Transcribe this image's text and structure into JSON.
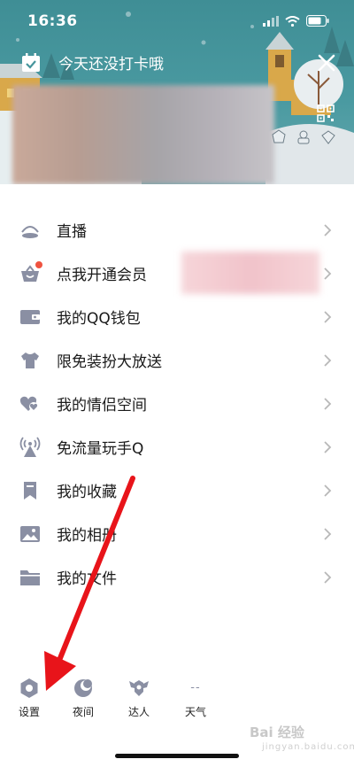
{
  "status_bar": {
    "time": "16:36",
    "icons": [
      "signal-icon",
      "wifi-icon",
      "battery-icon"
    ]
  },
  "header": {
    "checkin_text": "今天还没打卡哦",
    "checkin_icon": "calendar-check-icon",
    "close_icon": "close-icon",
    "qr_icon": "qr-code-icon",
    "badge_icons": [
      "badge-1-icon",
      "badge-2-icon",
      "badge-3-icon"
    ]
  },
  "menu": {
    "items": [
      {
        "label": "直播",
        "icon": "live-icon"
      },
      {
        "label": "点我开通会员",
        "icon": "vip-basket-icon",
        "has_red_dot": true
      },
      {
        "label": "我的QQ钱包",
        "icon": "wallet-icon"
      },
      {
        "label": "限免装扮大放送",
        "icon": "tshirt-icon"
      },
      {
        "label": "我的情侣空间",
        "icon": "hearts-icon"
      },
      {
        "label": "免流量玩手Q",
        "icon": "signal-tower-icon"
      },
      {
        "label": "我的收藏",
        "icon": "bookmark-icon"
      },
      {
        "label": "我的相册",
        "icon": "photo-icon"
      },
      {
        "label": "我的文件",
        "icon": "folder-icon"
      }
    ]
  },
  "bottom_bar": {
    "items": [
      {
        "label": "设置",
        "icon": "settings-icon"
      },
      {
        "label": "夜间",
        "icon": "moon-icon"
      },
      {
        "label": "达人",
        "icon": "talent-icon"
      },
      {
        "label": "天气",
        "icon": "--"
      }
    ]
  },
  "watermark": {
    "text": "Bai 经验",
    "sub": "jingyan.baidu.com"
  },
  "colors": {
    "header_teal": "#46959c",
    "icon_gray": "#8a8fa3",
    "red_dot": "#ef5340",
    "arrow_red": "#e8141a"
  }
}
